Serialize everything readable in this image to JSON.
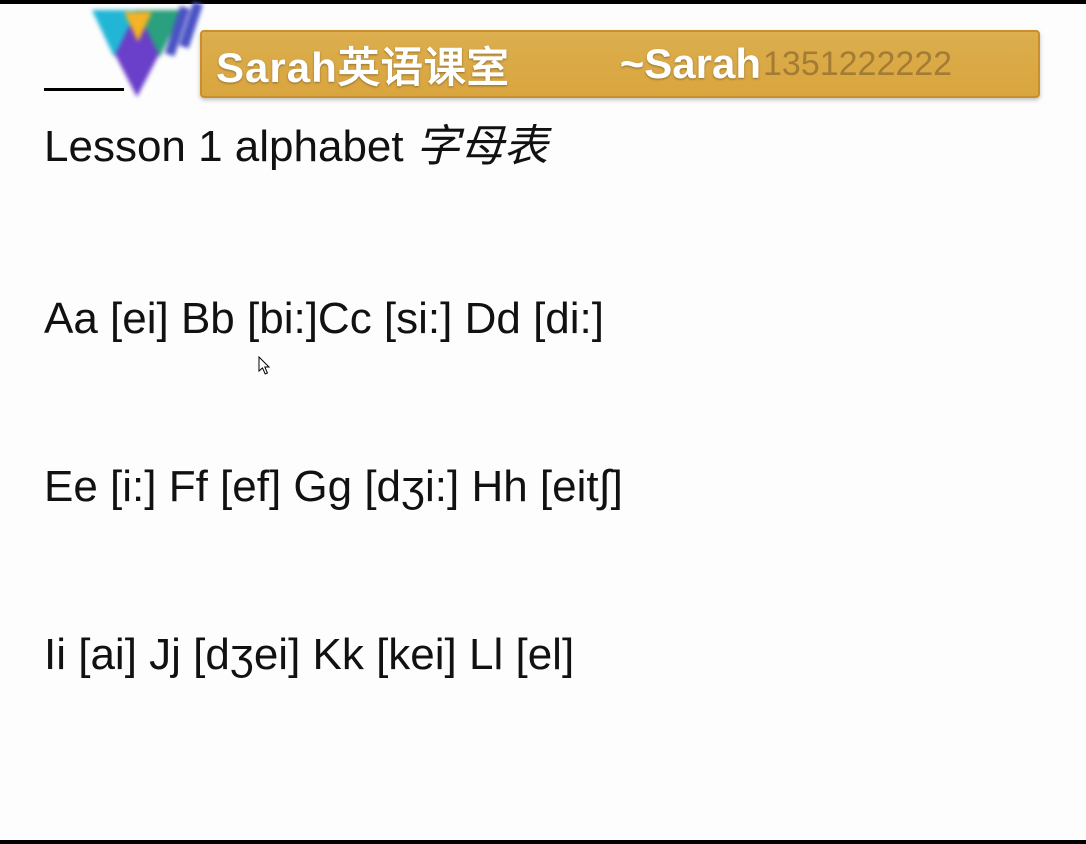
{
  "banner": {
    "title": "Sarah英语课室",
    "sub_prefix": "~ ",
    "sub_name": "Sarah",
    "faded_text": "1351222222"
  },
  "lesson": {
    "heading_en": "Lesson 1  alphabet ",
    "heading_cn": "字母表"
  },
  "rows": {
    "r1": "Aa [ei]  Bb [bi:]Cc [si:] Dd [di:]",
    "r2": "Ee [i:]  Ff [ef]  Gg [dʒi:] Hh [eit∫]",
    "r3": "Ii [ai]  Jj [dʒei]  Kk [kei]   Ll [el]"
  }
}
